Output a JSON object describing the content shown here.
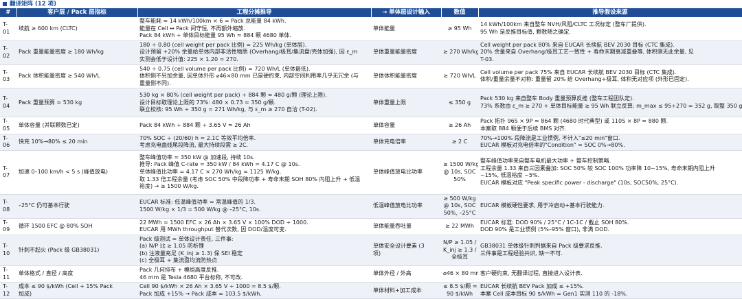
{
  "title": "翻译矩阵 (12 项)",
  "headers": [
    "#",
    "客户层 / Pack 层指标",
    "工程分摊推导",
    "→ 单体层设计输入",
    "数值",
    "推导假设来源"
  ],
  "rows": [
    {
      "id": "T-01",
      "target": [
        "续航 ≥ 600 km (CLTC)"
      ],
      "derivation": [
        "整车能耗 ≈ 14 kWh/100km × 6 = Pack 总能量 84 kWh.",
        "能量在 Cell ↔ Pack 间守恒, 不再额外缩放.",
        "Pack 84 kWh ÷ 单体目标能量 95 Wh ≈ 884 颗 4680 单体."
      ],
      "input": [
        "单体能量"
      ],
      "value": [
        "≥ 95 Wh"
      ],
      "source": [
        "14 kWh/100km 来自整车 NVH/风阻/CLTC 工况标定 (整车厂提供).",
        "95 Wh 是反推目标值, 颗数随之确定."
      ]
    },
    {
      "id": "T-02",
      "target": [
        "Pack 重量能量密度 ≥ 180 Wh/kg"
      ],
      "derivation": [
        "180 ÷ 0.80 (cell weight per pack 比例) = 225 Wh/kg (单体层).",
        "设计预留 +20% 余量给单体内部非活性物质 (Overhang/极耳/集流盘/壳体加强), 因 ε_m",
        "实测会低于设计值: 225 × 1.20 = 270."
      ],
      "input": [
        "单体重量能量密度"
      ],
      "value": [
        "≥ 270 Wh/kg"
      ],
      "source": [
        "Cell weight per pack 80% 来自 EUCAR 长续航 BEV 2030 目标 (CTC 集成).",
        "20% 余量来自 Overhang/极耳工艺一致性 + 寿命末期衰减重叠等, 体积侧无此余量, 见",
        "T-03."
      ]
    },
    {
      "id": "T-03",
      "target": [
        "Pack 体积能量密度 ≥ 540 Wh/L"
      ],
      "derivation": [
        "540 ÷ 0.75 (cell volume per pack 比例) = 720 Wh/L (单体最低).",
        "体积侧不另加余量, 因单体外形 ⌀46×80 mm 已是硬约束, 内部空间利用率几乎无冗余 (与",
        "重量侧不同)."
      ],
      "input": [
        "单体体积能量密度"
      ],
      "value": [
        "≥ 720 Wh/L"
      ],
      "source": [
        "Cell volume per pack 75% 来自 EUCAR 长续航 BEV 2030 目标 (CTC 集成).",
        "体积/重量余量不对称: 重量留 20% 给 Overhang+极耳, 体积无对应项 (外形已固定)."
      ]
    },
    {
      "id": "T-04",
      "target": [
        "Pack 重量预算 ≈ 530 kg"
      ],
      "derivation": [
        "530 kg × 80% (cell weight per pack) ÷ 884 颗 ≈ 480 g/颗 (理论上限).",
        "设计目标取理论上限的 73%: 480 × 0.73 ≈ 350 g/颗.",
        "联立校核: 95 Wh ÷ 350 g = 271 Wh/kg, 与 ε_m ≥ 270 自洽 (T-02)."
      ],
      "input": [
        "单体重量上限"
      ],
      "value": [
        "≤ 350 g"
      ],
      "source": [
        "Pack 530 kg 来自整车 Body 重量预算反推 (整车工程团队定).",
        "73% 系数由 ε_m ≥ 270 + 单体目标能量 ≥ 95 Wh 联立反算: m_max ≤ 95÷270 = 352 g, 取整 350 g."
      ]
    },
    {
      "id": "T-05",
      "target": [
        "单体容量 (并联颗数已定)"
      ],
      "derivation": [
        "Pack 84 kWh ÷ 884 颗 ÷ 3.65 V ≈ 26 Ah"
      ],
      "input": [
        "单体容量"
      ],
      "value": [
        "≥ 26 Ah"
      ],
      "source": [
        "Pack 拓扑 96S × 9P ≈ 864 颗 (4680 时代典型) 或 110S × 8P ≈ 880 颗.",
        "本案取 884 颗便于后续 BMS 对齐."
      ]
    },
    {
      "id": "T-06",
      "target": [
        "快充 10%→80% ≤ 20 min"
      ],
      "derivation": [
        "70% SOC ÷ (20/60) h = 2.1C 等效平均倍率.",
        "考虑充电曲线尾段降流, 最大持续段需 ≥ 2C."
      ],
      "input": [
        "单体充电倍率"
      ],
      "value": [
        "≥ 2 C"
      ],
      "source": [
        "70%→100% 段降流是工业惯例, 不计入\"≤20 min\"窗口.",
        "EUCAR 模板对充电倍率的\"Condition\" = SOC 0%→80%."
      ]
    },
    {
      "id": "T-07",
      "target": [
        "加速 0–100 km/h < 5 s (峰值放电)"
      ],
      "derivation": [
        "整车峰值功率 ≈ 350 kW @ 加速段, 持续 10s.",
        "推导: Pack 峰值 C-rate = 350 kW / 84 kWh = 4.17 C @ 10s.",
        "单体峰值比功率 = 4.17 C × 270 Wh/kg ≈ 1125 W/kg.",
        "取 1.33 倍工程余量 (考虑 SOC 50% 中段降功率 + 寿命末期 SOH 80% 内阻上升 + 低温",
        "裕度) → ≥ 1500 W/kg."
      ],
      "input": [
        "单体峰值放电比功率"
      ],
      "value": [
        "≥ 1500 W/kg",
        "@ 10s, SOC",
        "50%"
      ],
      "source": [
        "整车峰值功率来自整车电机最大功率 + 整车控制策略.",
        "工程余量 1.33 来自三因素叠加: SOC 50% 较 SOC 100% 功率降 10~15%, 寿命末期内阻上升",
        "~15%, 低温裕度 ~5%.",
        "EUCAR 模板对应 \"Peak specific power - discharge\" (10s, SOC50%, 25°C)."
      ]
    },
    {
      "id": "T-08",
      "target": [
        "–25°C 仍可基本行驶"
      ],
      "derivation": [
        "EUCAR 标准: 低温峰值功率 = 常温峰值的 1/3.",
        "1500 W/kg × 1/3 = 500 W/kg @ –25°C, 10s."
      ],
      "input": [
        "低温峰值放电比功率"
      ],
      "value": [
        "≥ 500 W/kg",
        "@ 10s, SOC",
        "50%, –25°C"
      ],
      "source": [
        "EUCAR 模板硬性要求, 用于冷启动+基本行驶能力."
      ]
    },
    {
      "id": "T-09",
      "target": [
        "循环 1500 EFC @ 80% SOH"
      ],
      "derivation": [
        "22 MWh ≈ 1500 EFC × 26 Ah × 3.65 V × 100% DOD ÷ 1000.",
        "EUCAR 用 MWh throughput 替代次数, 因 DOD/温度可变."
      ],
      "input": [
        "单体能量吞吐量"
      ],
      "value": [
        "≥ 22 MWh"
      ],
      "source": [
        "EUCAR 标准: DOD 90% / 25°C / 1C-1C / 截止 SOH 80%.",
        "DOD 90% 是工业惯例 (5%–95% 窗口), 非满 DOD."
      ]
    },
    {
      "id": "T-10",
      "target": [
        "针刺不起火 (Pack 级 GB38031)"
      ],
      "derivation": [
        "Pack 级测试 = 单体设计责任, 三件事:",
        "(a) N/P 比 ≥ 1.05 防析锂",
        "(b) 注液量充足 (K_inj ≥ 1.3) 保 SEI 稳定",
        "(c) 全极耳 + 集流盘均流防热点"
      ],
      "input": [
        "单体安全设计要素 (3",
        "项)"
      ],
      "value": [
        "N/P ≥ 1.05 /",
        "K_inj ≥ 1.3 /",
        "全极耳"
      ],
      "source": [
        "GB38031 单体级针刺判据来自 Pack 级要求反推.",
        "三件事是工程经验共识, 缺一不可."
      ]
    },
    {
      "id": "T-11",
      "target": [
        "单体格式 / 直径 / 高度"
      ],
      "derivation": [
        "Pack 几何排布 + 模组高度反推.",
        "46 mm 是 Tesla 4680 平台标称, 不可改."
      ],
      "input": [
        "单体外径 / 外高"
      ],
      "value": [
        "⌀46 × 80 mm"
      ],
      "source": [
        "客户硬约束, 无翻译过程, 直接进入设计表."
      ]
    },
    {
      "id": "T-12",
      "target": [
        "成本 ≤ 90 $/kWh (Cell + 15% Pack",
        "加成)"
      ],
      "derivation": [
        "Cell 90 $/kWh × 26 Ah × 3.65 V ÷ 1000 = 8.5 $/颗.",
        "Pack 加成 +15% → Pack 成本 ≈ 103.5 $/kWh."
      ],
      "input": [
        "单体材料+加工成本"
      ],
      "value": [
        "≤ 8.5 $/颗 ≈",
        "90 $/kWh"
      ],
      "source": [
        "EUCAR 长续航 BEV Pack 加成 ≤ +15%.",
        "本案 Cell 成本目标 90 $/kWh = Gen1 实测 110 的 -18%."
      ]
    }
  ]
}
